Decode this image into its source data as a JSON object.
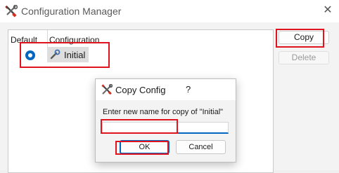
{
  "window": {
    "title": "Configuration Manager",
    "close_glyph": "✕",
    "app_icon": "tools-icon"
  },
  "list": {
    "columns": [
      "Default",
      "Configuration"
    ],
    "items": [
      {
        "label": "Initial",
        "default": true,
        "icon": "wrench-icon"
      }
    ]
  },
  "buttons": {
    "copy": "Copy",
    "delete": "Delete"
  },
  "dialog": {
    "title": "Copy Config",
    "help": "?",
    "prompt": "Enter new name for copy of \"Initial\"",
    "input_value": "",
    "ok": "OK",
    "cancel": "Cancel"
  },
  "colors": {
    "accent": "#0067c0",
    "highlight": "#e0141e"
  }
}
